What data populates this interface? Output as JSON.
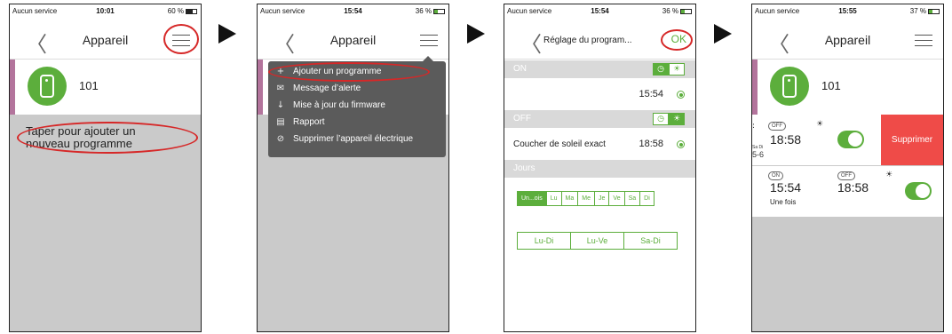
{
  "screen1": {
    "status": {
      "carrier": "Aucun service",
      "time": "10:01",
      "battery": "60 %"
    },
    "title": "Appareil",
    "device_name": "101",
    "hint_line1": "Taper pour ajouter un",
    "hint_line2": "nouveau programme"
  },
  "screen2": {
    "status": {
      "carrier": "Aucun service",
      "time": "15:54",
      "battery": "36 %"
    },
    "title": "Appareil",
    "menu": [
      {
        "icon": "+",
        "label": "Ajouter un programme"
      },
      {
        "icon": "✉",
        "label": "Message d’alerte"
      },
      {
        "icon": "↓",
        "label": "Mise à jour du firmware"
      },
      {
        "icon": "▤",
        "label": "Rapport"
      },
      {
        "icon": "⊘",
        "label": "Supprimer l’appareil électrique"
      }
    ]
  },
  "screen3": {
    "status": {
      "carrier": "Aucun service",
      "time": "15:54",
      "battery": "36 %"
    },
    "title": "Réglage du program...",
    "ok_label": "OK",
    "on_label": "ON",
    "on_time": "15:54",
    "off_label": "OFF",
    "sunset_label": "Coucher de soleil exact",
    "off_time": "18:58",
    "days_label": "Jours",
    "days": [
      "Un...ois",
      "Lu",
      "Ma",
      "Me",
      "Je",
      "Ve",
      "Sa",
      "Di"
    ],
    "ranges": [
      "Lu-Di",
      "Lu-Ve",
      "Sa-Di"
    ]
  },
  "screen4": {
    "status": {
      "carrier": "Aucun service",
      "time": "15:55",
      "battery": "37 %"
    },
    "title": "Appareil",
    "device_name": "101",
    "row1": {
      "off_tag": "OFF",
      "off_time": "18:58",
      "delete_label": "Supprimer",
      "cut_day_top": "Sa Di",
      "cut_day_bottom": "5-6"
    },
    "row2": {
      "on_tag": "ON",
      "on_time": "15:54",
      "off_tag": "OFF",
      "off_time": "18:58",
      "repeat": "Une fois"
    }
  },
  "colors": {
    "accent_green": "#5cae3c",
    "device_stripe": "#b3749c",
    "delete_red": "#ef4b48",
    "highlight_red": "#d62828"
  },
  "icons": [
    "back-chevron-icon",
    "hamburger-menu-icon",
    "plug-icon",
    "clock-icon",
    "sun-icon",
    "next-step-arrow-icon"
  ]
}
